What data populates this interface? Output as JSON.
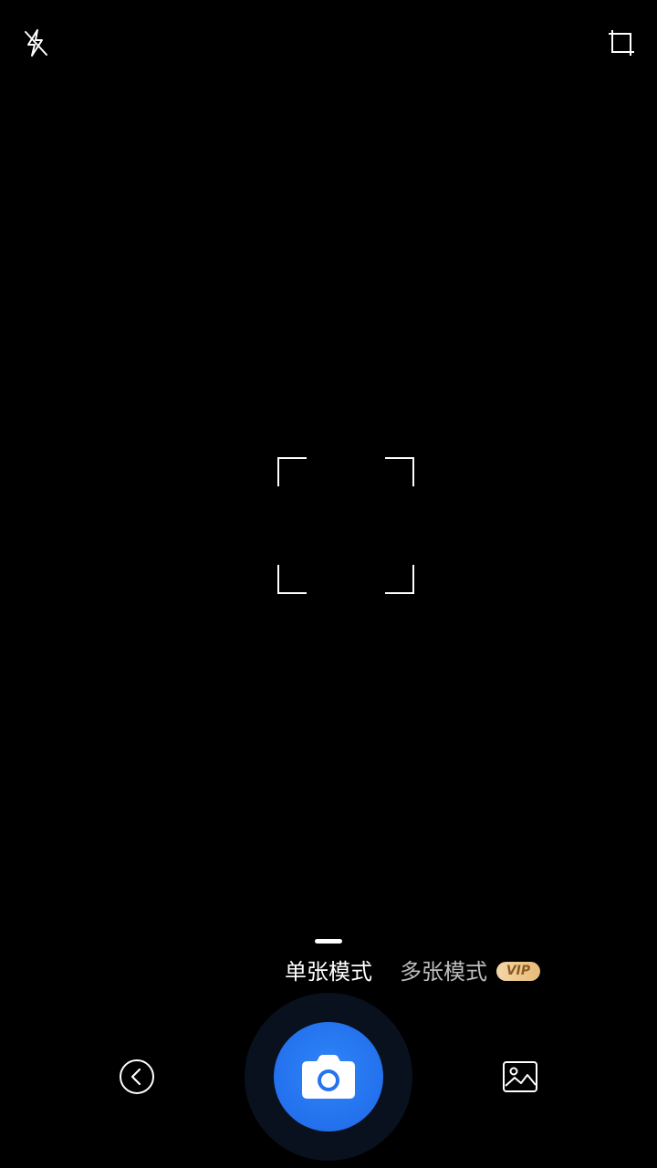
{
  "top_bar": {
    "flash_icon": "flash-off-icon",
    "crop_icon": "crop-icon"
  },
  "viewfinder": {
    "focus_frame_icon": "focus-frame-icon"
  },
  "modes": {
    "single_label": "单张模式",
    "multi_label": "多张模式",
    "vip_badge": "VIP",
    "active": "single"
  },
  "bottom_bar": {
    "back_icon": "back-arrow-icon",
    "shutter_icon": "camera-icon",
    "gallery_icon": "gallery-icon"
  },
  "colors": {
    "background": "#000000",
    "shutter": "#2573ef",
    "vip_gold": "#e7bb78",
    "active_mode": "#ffffff",
    "inactive_mode": "#bdbdbd"
  }
}
